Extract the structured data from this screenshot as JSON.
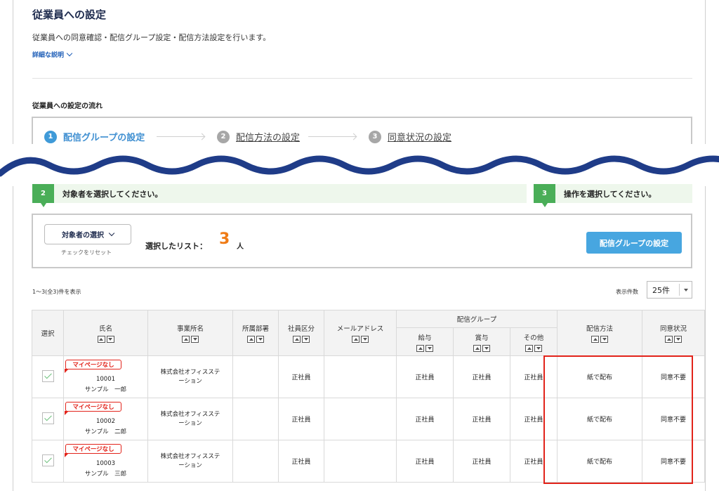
{
  "page": {
    "title": "従業員への設定",
    "description": "従業員への同意確認・配信グループ設定・配信方法設定を行います。",
    "detail_link": "詳細な説明"
  },
  "flow": {
    "title": "従業員への設定の流れ",
    "steps": [
      {
        "num": "1",
        "label": "配信グループの設定",
        "state": "active"
      },
      {
        "num": "2",
        "label": "配信方法の設定",
        "state": "link"
      },
      {
        "num": "3",
        "label": "同意状況の設定",
        "state": "link"
      }
    ]
  },
  "instructions": {
    "step2": {
      "num": "2",
      "text": "対象者を選択してください。"
    },
    "step3": {
      "num": "3",
      "text": "操作を選択してください。"
    }
  },
  "selection": {
    "target_select_label": "対象者の選択",
    "reset_link": "チェックをリセット",
    "selected_label": "選択したリスト：",
    "selected_count": "3",
    "selected_unit": "人",
    "action_button": "配信グループの設定"
  },
  "list": {
    "range_info": "1〜3(全3)件を表示",
    "per_page_label": "表示件数",
    "per_page_value": "25件"
  },
  "table": {
    "headers": {
      "select": "選択",
      "name": "氏名",
      "office": "事業所名",
      "department": "所属部署",
      "employee_type": "社員区分",
      "email": "メールアドレス",
      "delivery_group": "配信グループ",
      "salary": "給与",
      "bonus": "賞与",
      "other": "その他",
      "delivery_method": "配信方法",
      "consent_status": "同意状況"
    },
    "rows": [
      {
        "badge": "マイページなし",
        "emp_no": "10001",
        "name": "サンプル　一郎",
        "office_line1": "株式会社オフィスステ",
        "office_line2": "ーション",
        "department": "",
        "employee_type": "正社員",
        "email": "",
        "salary": "正社員",
        "bonus": "正社員",
        "other": "正社員",
        "delivery_method": "紙で配布",
        "consent_status": "同意不要"
      },
      {
        "badge": "マイページなし",
        "emp_no": "10002",
        "name": "サンプル　二郎",
        "office_line1": "株式会社オフィスステ",
        "office_line2": "ーション",
        "department": "",
        "employee_type": "正社員",
        "email": "",
        "salary": "正社員",
        "bonus": "正社員",
        "other": "正社員",
        "delivery_method": "紙で配布",
        "consent_status": "同意不要"
      },
      {
        "badge": "マイページなし",
        "emp_no": "10003",
        "name": "サンプル　三郎",
        "office_line1": "株式会社オフィスステ",
        "office_line2": "ーション",
        "department": "",
        "employee_type": "正社員",
        "email": "",
        "salary": "正社員",
        "bonus": "正社員",
        "other": "正社員",
        "delivery_method": "紙で配布",
        "consent_status": "同意不要"
      }
    ]
  },
  "colors": {
    "accent_blue": "#47a6e0",
    "step_green": "#4aae58",
    "count_orange": "#ef7b15",
    "highlight_red": "#e2231a",
    "wave_navy": "#1f3c88"
  }
}
